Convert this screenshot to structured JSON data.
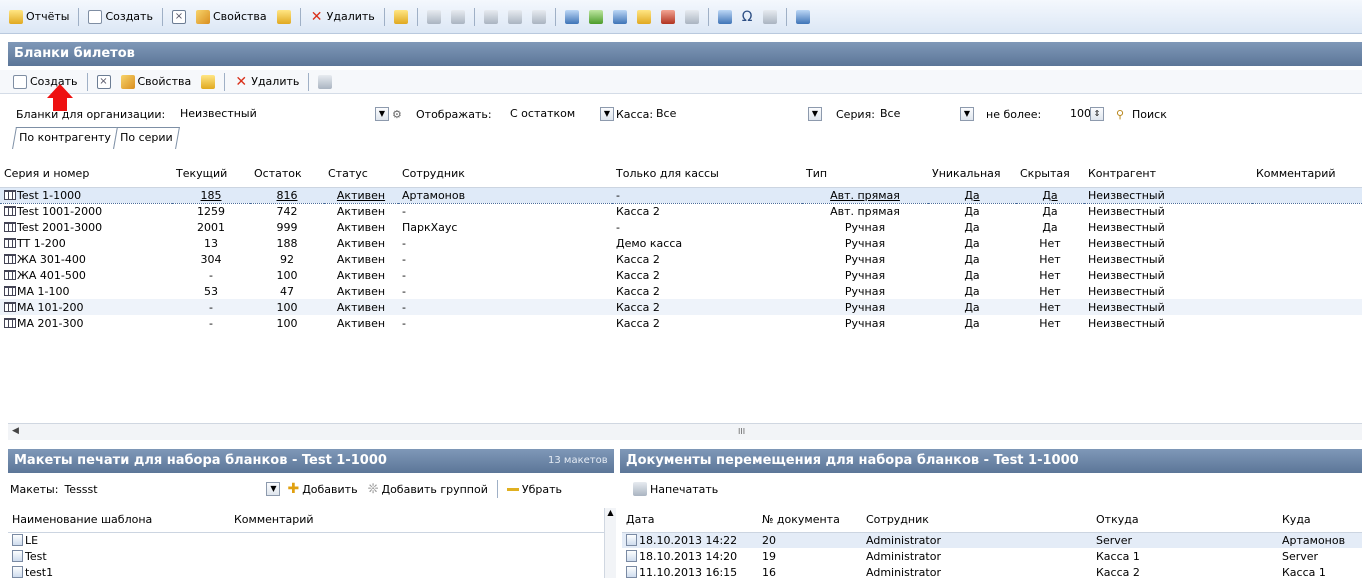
{
  "top_toolbar": {
    "reports": "Отчёты",
    "create": "Создать",
    "properties": "Свойства",
    "delete": "Удалить"
  },
  "main_panel": {
    "title": "Бланки билетов",
    "toolbar": {
      "create": "Создать",
      "properties": "Свойства",
      "delete": "Удалить"
    },
    "filters": {
      "org_label": "Бланки для организации:",
      "org_value": "Неизвестный",
      "display_label": "Отображать:",
      "display_value": "С остатком",
      "cashbox_label": "Касса:",
      "cashbox_value": "Все",
      "series_label": "Серия:",
      "series_value": "Все",
      "limit_label": "не более:",
      "limit_value": "100",
      "search": "Поиск"
    },
    "tabs": [
      "По контрагенту",
      "По серии"
    ],
    "columns": [
      "Серия и номер",
      "Текущий",
      "Остаток",
      "Статус",
      "Сотрудник",
      "Только для кассы",
      "Тип",
      "Уникальная",
      "Скрытая",
      "Контрагент",
      "Комментарий"
    ],
    "rows": [
      [
        "Test 1-1000",
        "185",
        "816",
        "Активен",
        "Артамонов",
        "-",
        "Авт. прямая",
        "Да",
        "Да",
        "Неизвестный",
        ""
      ],
      [
        "Test 1001-2000",
        "1259",
        "742",
        "Активен",
        "-",
        "Касса 2",
        "Авт. прямая",
        "Да",
        "Да",
        "Неизвестный",
        ""
      ],
      [
        "Test 2001-3000",
        "2001",
        "999",
        "Активен",
        "ПаркХаус",
        "-",
        "Ручная",
        "Да",
        "Да",
        "Неизвестный",
        ""
      ],
      [
        "TT 1-200",
        "13",
        "188",
        "Активен",
        "-",
        "Демо касса",
        "Ручная",
        "Да",
        "Нет",
        "Неизвестный",
        ""
      ],
      [
        "ЖА 301-400",
        "304",
        "92",
        "Активен",
        "-",
        "Касса 2",
        "Ручная",
        "Да",
        "Нет",
        "Неизвестный",
        ""
      ],
      [
        "ЖА 401-500",
        "-",
        "100",
        "Активен",
        "-",
        "Касса 2",
        "Ручная",
        "Да",
        "Нет",
        "Неизвестный",
        ""
      ],
      [
        "МА 1-100",
        "53",
        "47",
        "Активен",
        "-",
        "Касса 2",
        "Ручная",
        "Да",
        "Нет",
        "Неизвестный",
        ""
      ],
      [
        "МА 101-200",
        "-",
        "100",
        "Активен",
        "-",
        "Касса 2",
        "Ручная",
        "Да",
        "Нет",
        "Неизвестный",
        ""
      ],
      [
        "МА 201-300",
        "-",
        "100",
        "Активен",
        "-",
        "Касса 2",
        "Ручная",
        "Да",
        "Нет",
        "Неизвестный",
        ""
      ]
    ],
    "scroll_grip": "III"
  },
  "layouts_panel": {
    "title": "Макеты печати для набора бланков - Test 1-1000",
    "count": "13 макетов",
    "label": "Макеты:",
    "value": "Tessst",
    "add": "Добавить",
    "add_group": "Добавить группой",
    "remove": "Убрать",
    "columns": [
      "Наименование шаблона",
      "Комментарий"
    ],
    "rows": [
      [
        "LE",
        ""
      ],
      [
        "Test",
        ""
      ],
      [
        "test1",
        ""
      ]
    ]
  },
  "documents_panel": {
    "title": "Документы перемещения для набора бланков - Test 1-1000",
    "print": "Напечатать",
    "columns": [
      "Дата",
      "№ документа",
      "Сотрудник",
      "Откуда",
      "Куда"
    ],
    "rows": [
      [
        "18.10.2013 14:22",
        "20",
        "Administrator",
        "Server",
        "Артамонов"
      ],
      [
        "18.10.2013 14:20",
        "19",
        "Administrator",
        "Касса 1",
        "Server"
      ],
      [
        "11.10.2013 16:15",
        "16",
        "Administrator",
        "Касса 2",
        "Касса 1"
      ]
    ]
  }
}
